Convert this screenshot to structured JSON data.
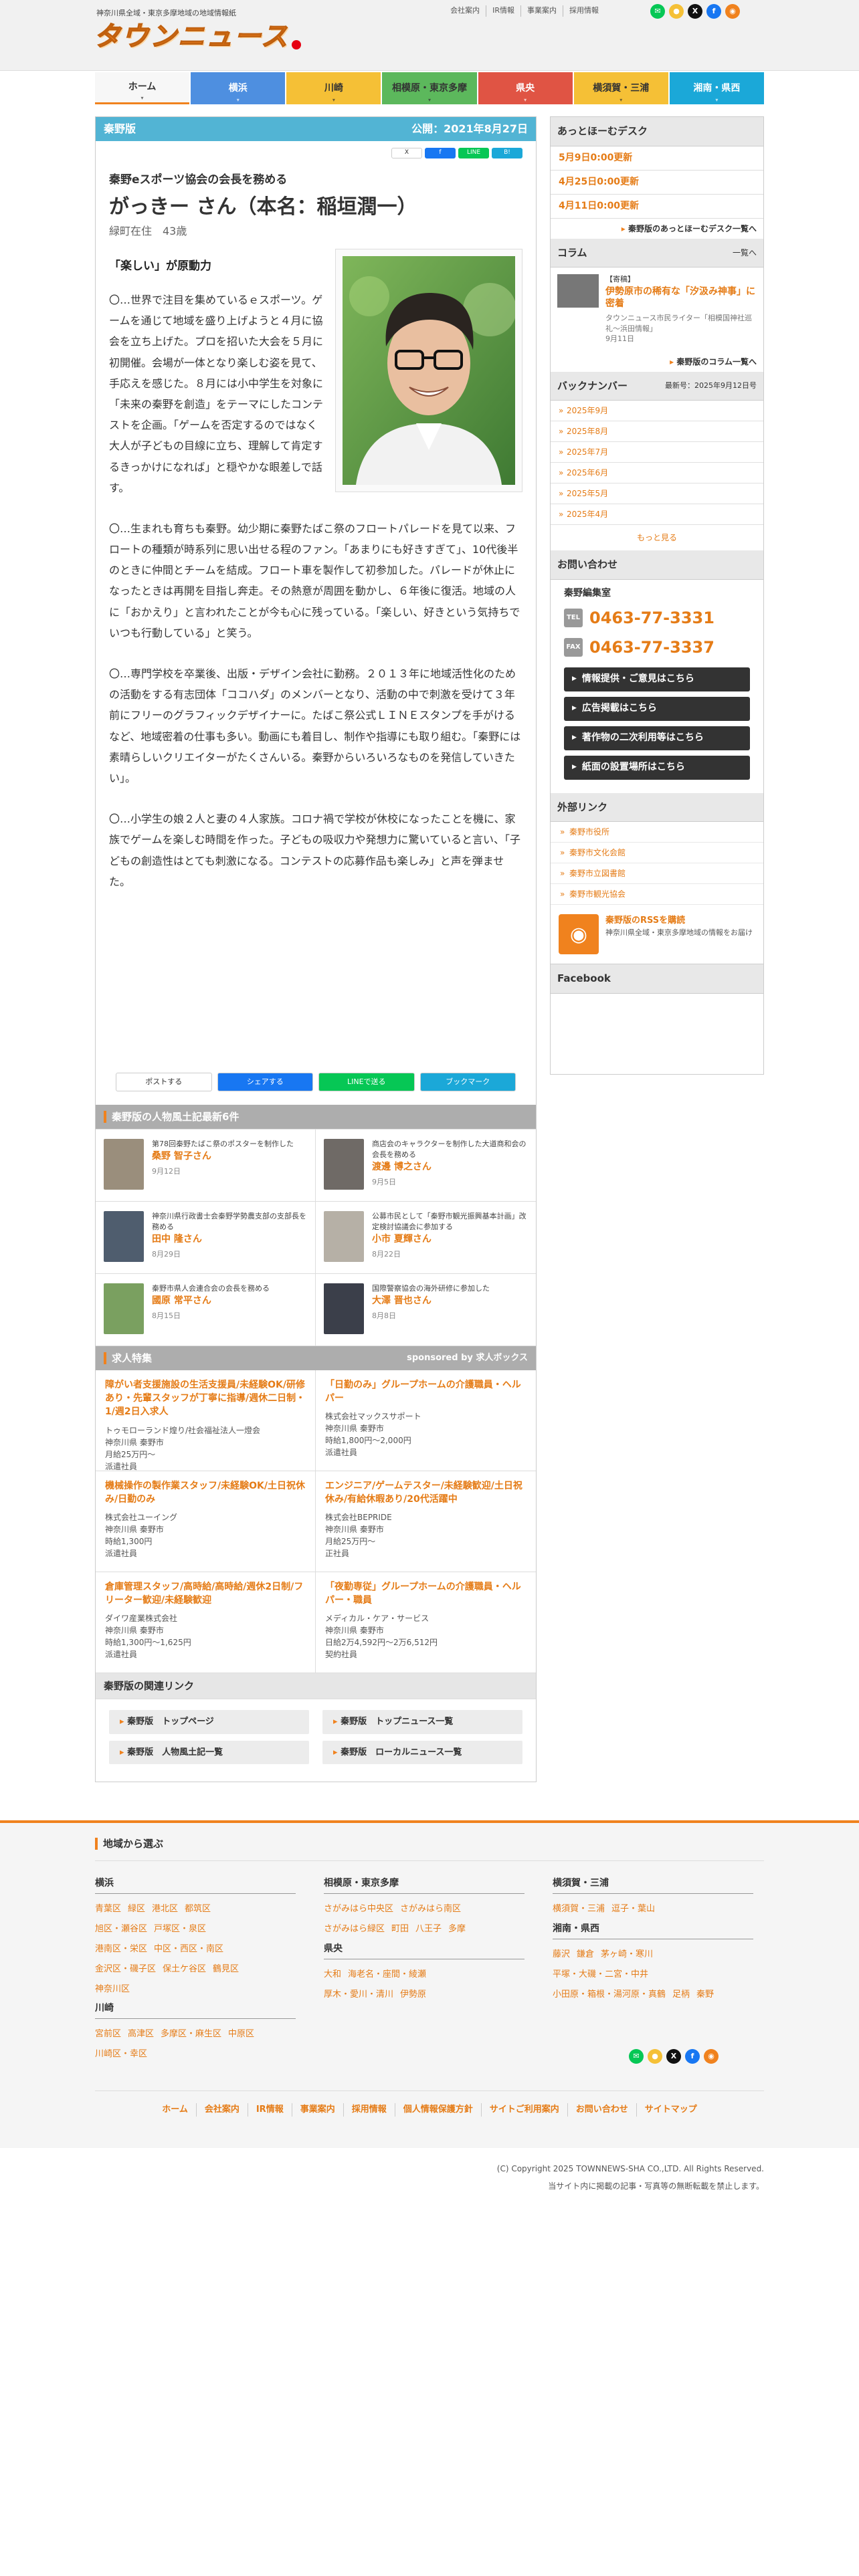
{
  "header": {
    "tagline": "神奈川県全域・東京多摩地域の地域情報紙",
    "logo": "タウンニュース",
    "toplinks": [
      "会社案内",
      "IR情報",
      "事業案内",
      "採用情報"
    ],
    "sns": [
      "LINE",
      "RSS",
      "X",
      "f",
      "RSS"
    ]
  },
  "nav": [
    {
      "label": "ホーム",
      "color": "#f7f7f7",
      "text": "#333"
    },
    {
      "label": "横浜",
      "color": "#4e8fe0",
      "text": "#fff"
    },
    {
      "label": "川崎",
      "color": "#f5c036",
      "text": "#333"
    },
    {
      "label": "相模原・東京多摩",
      "color": "#5cb85c",
      "text": "#333"
    },
    {
      "label": "県央",
      "color": "#e05444",
      "text": "#fff"
    },
    {
      "label": "横須賀・三浦",
      "color": "#f5c036",
      "text": "#333"
    },
    {
      "label": "湘南・県西",
      "color": "#1ba8d8",
      "text": "#fff"
    }
  ],
  "article": {
    "edition": "秦野版",
    "published": "公開：2021年8月27日",
    "share_mini": [
      "X",
      "f",
      "LINE",
      "B!"
    ],
    "subtitle": "秦野eスポーツ協会の会長を務める",
    "name": "がっきー さん（本名：稲垣潤一）",
    "desc": "緑町在住　43歳",
    "lead": "「楽しい」が原動力",
    "paragraphs": [
      "〇…世界で注目を集めているｅスポーツ。ゲームを通じて地域を盛り上げようと４月に協会を立ち上げた。プロを招いた大会を５月に初開催。会場が一体となり楽しむ姿を見て、手応えを感じた。８月には小中学生を対象に「未来の秦野を創造」をテーマにしたコンテストを企画。「ゲームを否定するのではなく大人が子どもの目線に立ち、理解して肯定するきっかけになれば」と穏やかな眼差しで話す。",
      "〇…生まれも育ちも秦野。幼少期に秦野たばこ祭のフロートパレードを見て以来、フロートの種類が時系列に思い出せる程のファン。「あまりにも好きすぎて」、10代後半のときに仲間とチームを結成。フロート車を製作して初参加した。パレードが休止になったときは再開を目指し奔走。その熱意が周囲を動かし、６年後に復活。地域の人に「おかえり」と言われたことが今も心に残っている。「楽しい、好きという気持ちでいつも行動している」と笑う。",
      "〇…専門学校を卒業後、出版・デザイン会社に勤務。２０１３年に地域活性化のための活動をする有志団体「ココハダ」のメンバーとなり、活動の中で刺激を受けて３年前にフリーのグラフィックデザイナーに。たばこ祭公式ＬＩＮＥスタンプを手がけるなど、地域密着の仕事も多い。動画にも着目し、制作や指導にも取り組む。「秦野には素晴らしいクリエイターがたくさんいる。秦野からいろいろなものを発信していきたい」。",
      "〇…小学生の娘２人と妻の４人家族。コロナ禍で学校が休校になったことを機に、家族でゲームを楽しむ時間を作った。子どもの吸収力や発想力に驚いていると言い、「子どもの創造性はとても刺激になる。コンテストの応募作品も楽しみ」と声を弾ませた。"
    ],
    "share_bar": [
      "ポストする",
      "シェアする",
      "LINEで送る",
      "ブックマーク"
    ]
  },
  "people": {
    "title": "秦野版の人物風土記最新6件",
    "items": [
      {
        "desc": "第78回秦野たばこ祭のポスターを制作した",
        "name": "桑野 智子さん",
        "date": "9月12日"
      },
      {
        "desc": "商店会のキャラクターを制作した大道商和会の会長を務める",
        "name": "渡邊 博之さん",
        "date": "9月5日"
      },
      {
        "desc": "神奈川県行政書士会秦野学勢農支部の支部長を務める",
        "name": "田中 隆さん",
        "date": "8月29日"
      },
      {
        "desc": "公募市民として「秦野市観光振興基本計画」改定検討協議会に参加する",
        "name": "小市 夏輝さん",
        "date": "8月22日"
      },
      {
        "desc": "秦野市県人会連合会の会長を務める",
        "name": "國原 常平さん",
        "date": "8月15日"
      },
      {
        "desc": "国際警察協会の海外研修に参加した",
        "name": "大澤 晋也さん",
        "date": "8月8日"
      }
    ]
  },
  "jobs": {
    "title": "求人特集",
    "sponsor": "sponsored by 求人ボックス",
    "items": [
      {
        "title": "障がい者支援施設の生活支援員/未経験OK/研修あり・先輩スタッフが丁寧に指導/週休二日制・1/週2日入求人",
        "company": "トゥモローランド煌り/社会福祉法人一燈会",
        "loc": "神奈川県 秦野市",
        "pay": "月給25万円～",
        "type": "派遣社員"
      },
      {
        "title": "「日勤のみ」グループホームの介護職員・ヘルパー",
        "company": "株式会社マックスサポート",
        "loc": "神奈川県 秦野市",
        "pay": "時給1,800円～2,000円",
        "type": "派遣社員"
      },
      {
        "title": "機械操作の製作業スタッフ/未経験OK/土日祝休み/日勤のみ",
        "company": "株式会社ユーイング",
        "loc": "神奈川県 秦野市",
        "pay": "時給1,300円",
        "type": "派遣社員"
      },
      {
        "title": "エンジニア/ゲームテスター/未経験歓迎/土日祝休み/有給休暇あり/20代活躍中",
        "company": "株式会社BEPRIDE",
        "loc": "神奈川県 秦野市",
        "pay": "月給25万円～",
        "type": "正社員"
      },
      {
        "title": "倉庫管理スタッフ/高時給/高時給/週休2日制/フリーター歓迎/未経験歓迎",
        "company": "ダイワ産業株式会社",
        "loc": "神奈川県 秦野市",
        "pay": "時給1,300円～1,625円",
        "type": "派遣社員"
      },
      {
        "title": "「夜勤専従」グループホームの介護職員・ヘルパー・職員",
        "company": "メディカル・ケア・サービス",
        "loc": "神奈川県 秦野市",
        "pay": "日給2万4,592円～2万6,512円",
        "type": "契約社員"
      }
    ]
  },
  "related": {
    "title": "秦野版の関連リンク",
    "links": [
      "秦野版　トップページ",
      "秦野版　トップニュース一覧",
      "秦野版　人物風土記一覧",
      "秦野版　ローカルニュース一覧"
    ]
  },
  "sidebar": {
    "desk_title": "あっとほーむデスク",
    "desk_items": [
      "5月9日0:00更新",
      "4月25日0:00更新",
      "4月11日0:00更新"
    ],
    "desk_more": "秦野版のあっとほーむデスク一覧へ",
    "column_title": "コラム",
    "column_all": "一覧へ",
    "column_cat": "【寄稿】",
    "column_headline": "伊勢原市の稀有な「汐汲み神事」に密着",
    "column_author": "タウンニュース市民ライター「相模国神社巡礼～浜田情報」",
    "column_date": "9月11日",
    "column_more": "秦野版のコラム一覧へ",
    "backnumber_title": "バックナンバー",
    "backnumber_updated": "最新号：2025年9月12日号",
    "backnumbers": [
      "2025年9月",
      "2025年8月",
      "2025年7月",
      "2025年6月",
      "2025年5月",
      "2025年4月"
    ],
    "backnumber_more": "もっと見る",
    "contact_title": "お問い合わせ",
    "office": "秦野編集室",
    "tel_label": "TEL",
    "tel": "0463-77-3331",
    "fax_label": "FAX",
    "fax": "0463-77-3337",
    "buttons": [
      "情報提供・ご意見はこちら",
      "広告掲載はこちら",
      "著作物の二次利用等はこちら",
      "紙面の設置場所はこちら"
    ],
    "ext_title": "外部リンク",
    "ext_links": [
      "秦野市役所",
      "秦野市文化会館",
      "秦野市立図書館",
      "秦野市観光協会"
    ],
    "rss_title": "秦野版のRSSを購読",
    "rss_desc": "神奈川県全域・東京多摩地域の情報をお届け",
    "facebook": "Facebook"
  },
  "footer": {
    "title": "地域から選ぶ",
    "cols": [
      {
        "head": "横浜",
        "links": [
          "青葉区",
          "緑区",
          "港北区",
          "都筑区",
          "旭区・瀬谷区",
          "戸塚区・泉区",
          "港南区・栄区",
          "中区・西区・南区",
          "金沢区・磯子区",
          "保土ケ谷区",
          "鶴見区",
          "神奈川区"
        ]
      },
      {
        "head": "川崎",
        "links": [
          "宮前区",
          "高津区",
          "多摩区・麻生区",
          "中原区",
          "川崎区・幸区"
        ]
      },
      {
        "head": "相模原・東京多摩",
        "links": [
          "さがみはら中央区",
          "さがみはら南区",
          "さがみはら緑区",
          "町田",
          "八王子",
          "多摩"
        ]
      },
      {
        "head": "県央",
        "links": [
          "大和",
          "海老名・座間・綾瀬",
          "厚木・愛川・清川",
          "伊勢原"
        ]
      },
      {
        "head": "横須賀・三浦",
        "links": [
          "横須賀・三浦",
          "逗子・葉山"
        ]
      },
      {
        "head": "湘南・県西",
        "links": [
          "藤沢",
          "鎌倉",
          "茅ヶ崎・寒川",
          "平塚・大磯・二宮・中井",
          "小田原・箱根・湯河原・真鶴",
          "足柄",
          "秦野"
        ]
      }
    ],
    "nav": [
      "ホーム",
      "会社案内",
      "IR情報",
      "事業案内",
      "採用情報",
      "個人情報保護方針",
      "サイトご利用案内",
      "お問い合わせ",
      "サイトマップ"
    ],
    "copyright": "(C) Copyright 2025 TOWNNEWS-SHA CO.,LTD. All Rights Reserved.",
    "notice": "当サイト内に掲載の記事・写真等の無断転載を禁止します。"
  }
}
